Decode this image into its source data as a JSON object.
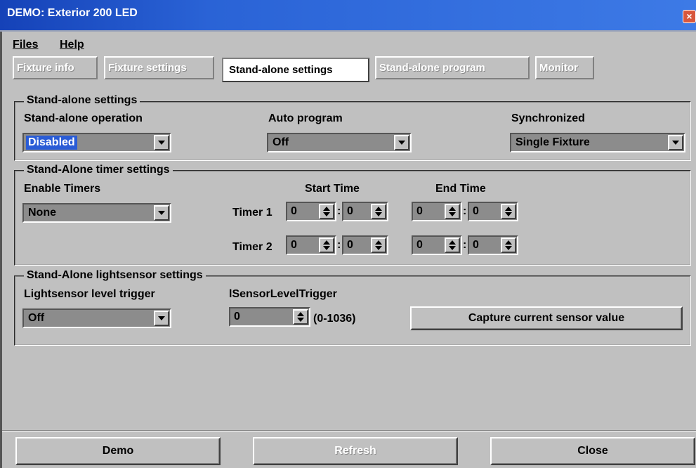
{
  "window": {
    "title": "DEMO: Exterior 200 LED",
    "close_icon": "×"
  },
  "menu": {
    "files": "Files",
    "help": "Help"
  },
  "tabs": [
    {
      "label": "Fixture info",
      "active": false
    },
    {
      "label": "Fixture settings",
      "active": false
    },
    {
      "label": "Stand-alone settings",
      "active": true
    },
    {
      "label": "Stand-alone program",
      "active": false
    },
    {
      "label": "Monitor",
      "active": false
    }
  ],
  "standalone": {
    "legend": "Stand-alone settings",
    "operation_label": "Stand-alone operation",
    "operation_value": "Disabled",
    "auto_program_label": "Auto program",
    "auto_program_value": "Off",
    "synchronized_label": "Synchronized",
    "synchronized_value": "Single Fixture"
  },
  "timers": {
    "legend": "Stand-Alone timer settings",
    "enable_label": "Enable Timers",
    "enable_value": "None",
    "start_time_label": "Start Time",
    "end_time_label": "End Time",
    "separator": ":",
    "timer1": {
      "label": "Timer 1",
      "start_h": "0",
      "start_m": "0",
      "end_h": "0",
      "end_m": "0"
    },
    "timer2": {
      "label": "Timer 2",
      "start_h": "0",
      "start_m": "0",
      "end_h": "0",
      "end_m": "0"
    }
  },
  "lightsensor": {
    "legend": "Stand-Alone lightsensor settings",
    "level_trigger_label": "Lightsensor level trigger",
    "level_trigger_value": "Off",
    "sensor_label": "lSensorLevelTrigger",
    "sensor_value": "0",
    "range": "(0-1036)",
    "capture_button": "Capture current sensor value"
  },
  "footer": {
    "demo": "Demo",
    "refresh": "Refresh",
    "close": "Close"
  },
  "colors": {
    "face": "#c0c0c0",
    "title_bar": "#2a63d6",
    "field": "#8c8c8c",
    "selection": "#2a5cd6"
  }
}
